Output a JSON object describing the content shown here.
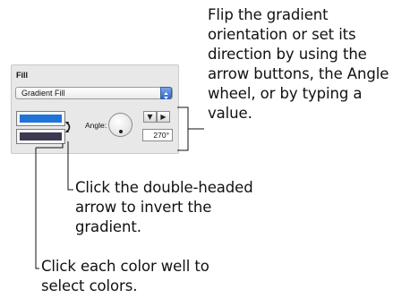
{
  "callouts": {
    "top": "Flip the gradient\norientation or set its\ndirection by using the\narrow buttons, the Angle\nwheel, or by typing a\nvalue.",
    "middle": "Click the double-headed\narrow to invert the\ngradient.",
    "bottom": "Click each color well to\nselect colors."
  },
  "fill_panel": {
    "title": "Fill",
    "dropdown_value": "Gradient Fill",
    "angle_label": "Angle:",
    "angle_value": "270°"
  },
  "colors": {
    "well_top": "#1f73d9",
    "well_bottom": "#3b3a52"
  },
  "icons": {
    "down_arrow_button": "down-arrow-icon",
    "right_arrow_button": "right-arrow-icon",
    "invert_arrow": "double-headed-arrow-icon",
    "dropdown_arrow": "stepper-arrows-icon"
  }
}
